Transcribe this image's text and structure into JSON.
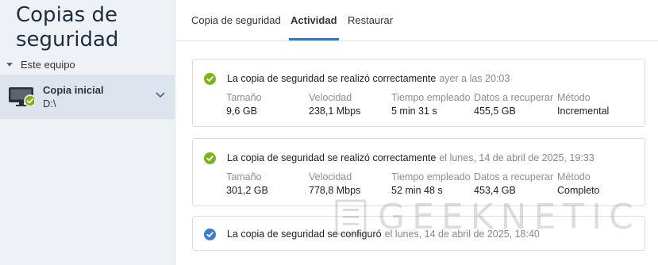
{
  "app": {
    "title": "Copias de seguridad"
  },
  "sidebar": {
    "section": "Este equipo",
    "device": {
      "name": "Copia inicial",
      "path": "D:\\"
    }
  },
  "tabs": [
    {
      "label": "Copia de seguridad",
      "active": false
    },
    {
      "label": "Actividad",
      "active": true
    },
    {
      "label": "Restaurar",
      "active": false
    }
  ],
  "labels": {
    "size": "Tamaño",
    "speed": "Velocidad",
    "time": "Tiempo empleado",
    "data": "Datos a recuperar",
    "method": "Método"
  },
  "activities": [
    {
      "status": "La copia de seguridad se realizó correctamente",
      "time": "ayer a las 20:03",
      "icon": "success-check-icon",
      "size": "9,6 GB",
      "speed": "238,1 Mbps",
      "duration": "5 min 31 s",
      "data": "455,5 GB",
      "method": "Incremental"
    },
    {
      "status": "La copia de seguridad se realizó correctamente",
      "time": "el lunes, 14 de abril de 2025, 19:33",
      "icon": "success-check-icon",
      "size": "301,2 GB",
      "speed": "778,8 Mbps",
      "duration": "52 min 48 s",
      "data": "453,4 GB",
      "method": "Completo"
    },
    {
      "status": "La copia de seguridad se configuró",
      "time": "el lunes, 14 de abril de 2025, 18:40",
      "icon": "info-check-icon"
    }
  ],
  "watermark": {
    "text": "GEEKNETIC"
  },
  "colors": {
    "success": "#7cb518",
    "info": "#3d7dd0",
    "accent": "#2d77c7",
    "sidebar": "#eef2f6",
    "selected": "#dce4ee"
  }
}
